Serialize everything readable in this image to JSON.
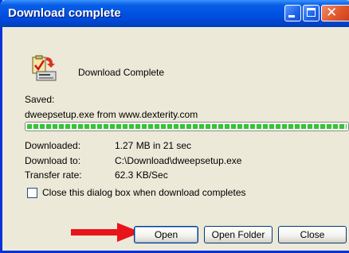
{
  "window": {
    "title": "Download complete"
  },
  "dialog": {
    "heading": "Download Complete",
    "saved_label": "Saved:",
    "file_line": "dweepsetup.exe from www.dexterity.com",
    "progress": {
      "percent": 100
    },
    "details": [
      {
        "label": "Downloaded:",
        "value": "1.27 MB in 21 sec"
      },
      {
        "label": "Download to:",
        "value": "C:\\Download\\dweepsetup.exe"
      },
      {
        "label": "Transfer rate:",
        "value": "62.3 KB/Sec"
      }
    ],
    "close_checkbox": {
      "label": "Close this dialog box when download completes",
      "checked": false
    }
  },
  "buttons": {
    "open": "Open",
    "open_folder": "Open Folder",
    "close": "Close"
  },
  "colors": {
    "titlebar": "#0054e3",
    "progress": "#37c237",
    "arrow": "#e8141b"
  },
  "icons": {
    "app": "download-check-icon",
    "annotation": "red-arrow-icon"
  }
}
